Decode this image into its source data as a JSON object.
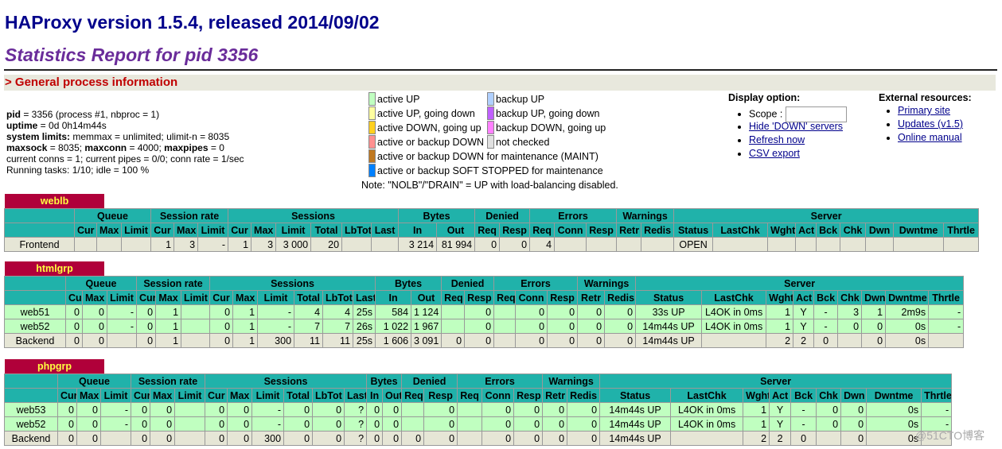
{
  "title": "HAProxy version 1.5.4, released 2014/09/02",
  "subtitle": "Statistics Report for pid 3356",
  "section": "> General process information",
  "process_info": [
    {
      "label": "pid",
      "text": " = 3356 (process #1, nbproc = 1)"
    },
    {
      "label": "uptime",
      "text": " = 0d 0h14m44s"
    },
    {
      "label": "system limits:",
      "text": " memmax = unlimited; ulimit-n = 8035"
    },
    {
      "label": "maxsock",
      "text": " = 8035; ",
      "label2": "maxconn",
      "text2": " = 4000; ",
      "label3": "maxpipes",
      "text3": " = 0"
    },
    {
      "label": "",
      "text": "current conns = 1; current pipes = 0/0; conn rate = 1/sec"
    },
    {
      "label": "",
      "text": "Running tasks: 1/10; idle = 100 %"
    }
  ],
  "legend_left": [
    {
      "text": "active UP",
      "color": "#c0ffc0"
    },
    {
      "text": "active UP, going down",
      "color": "#ffffa0"
    },
    {
      "text": "active DOWN, going up",
      "color": "#ffd020"
    },
    {
      "text": "active or backup DOWN",
      "color": "#ff9090"
    },
    {
      "text": "active or backup DOWN for maintenance (MAINT)",
      "color": "#c07820"
    },
    {
      "text": "active or backup SOFT STOPPED for maintenance",
      "color": "#0080ff"
    }
  ],
  "legend_right": [
    {
      "text": "backup UP",
      "color": "#b0d0ff"
    },
    {
      "text": "backup UP, going down",
      "color": "#c060ff"
    },
    {
      "text": "backup DOWN, going up",
      "color": "#ff80ff"
    },
    {
      "text": "not checked",
      "color": "#e0e0e0"
    }
  ],
  "legend_note": "Note: \"NOLB\"/\"DRAIN\" = UP with load-balancing disabled.",
  "display": {
    "title": "Display option:",
    "scope_label": "Scope :",
    "hide_down": "Hide 'DOWN' servers",
    "refresh": "Refresh now",
    "csv": "CSV export"
  },
  "external": {
    "title": "External resources:",
    "primary": "Primary site",
    "updates": "Updates (v1.5)",
    "manual": "Online manual"
  },
  "colors": {
    "title": "#00008b",
    "subtitle": "#6a2c9a",
    "proxy_tab": "#b0003a",
    "header": "#20b2aa",
    "up_row": "#c0ffc0",
    "fe_row": "#e6e6d6"
  },
  "header_groups": [
    "Queue",
    "Session rate",
    "Sessions",
    "Bytes",
    "Denied",
    "Errors",
    "Warnings",
    "Server"
  ],
  "header_cols": [
    "Cur",
    "Max",
    "Limit",
    "Cur",
    "Max",
    "Limit",
    "Cur",
    "Max",
    "Limit",
    "Total",
    "LbTot",
    "Last",
    "In",
    "Out",
    "Req",
    "Resp",
    "Req",
    "Conn",
    "Resp",
    "Retr",
    "Redis",
    "Status",
    "LastChk",
    "Wght",
    "Act",
    "Bck",
    "Chk",
    "Dwn",
    "Dwntme",
    "Thrtle"
  ],
  "proxies": [
    {
      "name": "weblb",
      "rows": [
        {
          "type": "fe",
          "cells": [
            "Frontend",
            "",
            "",
            "",
            "1",
            "3",
            "-",
            "1",
            "3",
            "3 000",
            "20",
            "",
            "",
            "3 214",
            "81 994",
            "0",
            "0",
            "4",
            "",
            "",
            "",
            "",
            "OPEN",
            "",
            "",
            "",
            "",
            "",
            "",
            "",
            ""
          ]
        }
      ]
    },
    {
      "name": "htmlgrp",
      "rows": [
        {
          "type": "up",
          "cells": [
            "web51",
            "0",
            "0",
            "-",
            "0",
            "1",
            "",
            "0",
            "1",
            "-",
            "4",
            "4",
            "25s",
            "584",
            "1 124",
            "",
            "0",
            "",
            "0",
            "0",
            "0",
            "0",
            "33s UP",
            "L4OK in 0ms",
            "1",
            "Y",
            "-",
            "3",
            "1",
            "2m9s",
            "-"
          ]
        },
        {
          "type": "up",
          "cells": [
            "web52",
            "0",
            "0",
            "-",
            "0",
            "1",
            "",
            "0",
            "1",
            "-",
            "7",
            "7",
            "26s",
            "1 022",
            "1 967",
            "",
            "0",
            "",
            "0",
            "0",
            "0",
            "0",
            "14m44s UP",
            "L4OK in 0ms",
            "1",
            "Y",
            "-",
            "0",
            "0",
            "0s",
            "-"
          ]
        },
        {
          "type": "be",
          "cells": [
            "Backend",
            "0",
            "0",
            "",
            "0",
            "1",
            "",
            "0",
            "1",
            "300",
            "11",
            "11",
            "25s",
            "1 606",
            "3 091",
            "0",
            "0",
            "",
            "0",
            "0",
            "0",
            "0",
            "14m44s UP",
            "",
            "2",
            "2",
            "0",
            "",
            "0",
            "0s",
            ""
          ]
        }
      ]
    },
    {
      "name": "phpgrp",
      "rows": [
        {
          "type": "up",
          "cells": [
            "web53",
            "0",
            "0",
            "-",
            "0",
            "0",
            "",
            "0",
            "0",
            "-",
            "0",
            "0",
            "?",
            "0",
            "0",
            "",
            "0",
            "",
            "0",
            "0",
            "0",
            "0",
            "14m44s UP",
            "L4OK in 0ms",
            "1",
            "Y",
            "-",
            "0",
            "0",
            "0s",
            "-"
          ]
        },
        {
          "type": "up",
          "cells": [
            "web52",
            "0",
            "0",
            "-",
            "0",
            "0",
            "",
            "0",
            "0",
            "-",
            "0",
            "0",
            "?",
            "0",
            "0",
            "",
            "0",
            "",
            "0",
            "0",
            "0",
            "0",
            "14m44s UP",
            "L4OK in 0ms",
            "1",
            "Y",
            "-",
            "0",
            "0",
            "0s",
            "-"
          ]
        },
        {
          "type": "be",
          "cells": [
            "Backend",
            "0",
            "0",
            "",
            "0",
            "0",
            "",
            "0",
            "0",
            "300",
            "0",
            "0",
            "?",
            "0",
            "0",
            "0",
            "0",
            "",
            "0",
            "0",
            "0",
            "0",
            "14m44s UP",
            "",
            "2",
            "2",
            "0",
            "",
            "0",
            "0s",
            ""
          ]
        }
      ]
    }
  ],
  "watermark": "@51CTO博客"
}
